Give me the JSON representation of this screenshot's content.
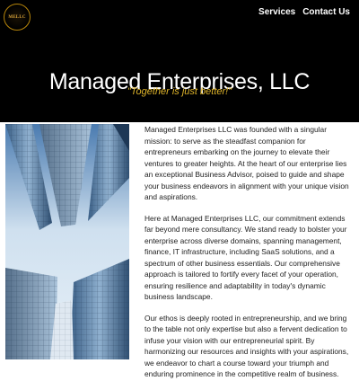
{
  "header": {
    "logo_text": "MELLC",
    "nav": [
      {
        "label": "Services"
      },
      {
        "label": "Contact Us"
      }
    ]
  },
  "hero": {
    "title": "Managed Enterprises, LLC",
    "tagline": "\"Together is just better!\""
  },
  "main": {
    "paragraphs": [
      "Managed Enterprises LLC was founded with a singular mission: to serve as the steadfast companion for entrepreneurs embarking on the journey to elevate their ventures to greater heights. At the heart of our enterprise lies an exceptional Business Advisor, poised to guide and shape your business endeavors in alignment with your unique vision and aspirations.",
      "Here at Managed Enterprises LLC, our commitment extends far beyond mere consultancy. We stand ready to bolster your enterprise across diverse domains, spanning management, finance, IT infrastructure, including SaaS solutions, and a spectrum of other business essentials. Our comprehensive approach is tailored to fortify every facet of your operation, ensuring resilience and adaptability in today's dynamic business landscape.",
      "Our ethos is deeply rooted in entrepreneurship, and we bring to the table not only expertise but also a fervent dedication to infuse your vision with our entrepreneurial spirit. By harmonizing our resources and insights with your aspirations, we endeavor to chart a course toward your triumph and enduring prominence in the competitive realm of business."
    ]
  },
  "colors": {
    "header_bg": "#000000",
    "tagline": "#e0b52a",
    "body_text": "#222222"
  }
}
